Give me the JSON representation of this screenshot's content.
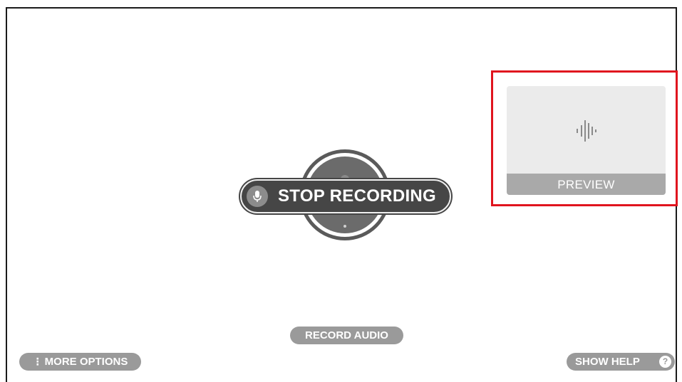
{
  "main": {
    "stop_button_label": "STOP RECORDING",
    "record_button_icon": "microphone-icon",
    "stop_button_icon": "microphone-icon"
  },
  "preview": {
    "label": "PREVIEW",
    "icon": "audio-waveform-icon",
    "highlight_color": "#e0141e"
  },
  "footer": {
    "record_audio_label": "RECORD AUDIO",
    "more_options_label": "MORE OPTIONS",
    "more_options_icon": "vertical-dots-icon",
    "show_help_label": "SHOW HELP",
    "help_icon_glyph": "?",
    "help_icon": "question-mark-icon"
  },
  "colors": {
    "stop_pill": "#464646",
    "pill_gray": "#9a9a9a",
    "preview_bg": "#ebebeb",
    "preview_bar": "#a9a9a9"
  }
}
